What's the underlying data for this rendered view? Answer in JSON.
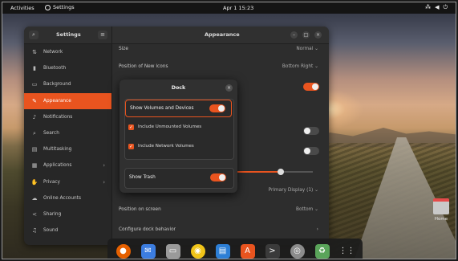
{
  "topbar": {
    "activities": "Activities",
    "app_name": "Settings",
    "clock": "Apr 1  15:23",
    "tray_icons": [
      "network-icon",
      "volume-icon",
      "power-icon"
    ]
  },
  "sidebar": {
    "title": "Settings",
    "items": [
      {
        "label": "Network",
        "icon": "network-icon"
      },
      {
        "label": "Bluetooth",
        "icon": "bluetooth-icon"
      },
      {
        "label": "Background",
        "icon": "background-icon"
      },
      {
        "label": "Appearance",
        "icon": "appearance-icon",
        "active": true
      },
      {
        "label": "Notifications",
        "icon": "bell-icon"
      },
      {
        "label": "Search",
        "icon": "search-icon"
      },
      {
        "label": "Multitasking",
        "icon": "multitasking-icon"
      },
      {
        "label": "Applications",
        "icon": "apps-icon",
        "chevron": true
      },
      {
        "label": "Privacy",
        "icon": "privacy-icon",
        "chevron": true
      },
      {
        "label": "Online Accounts",
        "icon": "cloud-icon"
      },
      {
        "label": "Sharing",
        "icon": "share-icon"
      },
      {
        "label": "Sound",
        "icon": "sound-icon"
      }
    ]
  },
  "main": {
    "title": "Appearance",
    "icon_size_label": "Size",
    "icon_size_value": "Normal",
    "new_icons_label": "Position of New Icons",
    "new_icons_value": "Bottom Right",
    "display_value": "Primary Display (1)",
    "position_label": "Position on screen",
    "position_value": "Bottom",
    "configure_label": "Configure dock behavior",
    "icon_size_slider_level": 0.6
  },
  "dock_dialog": {
    "title": "Dock",
    "show_volumes": {
      "label": "Show Volumes and Devices",
      "on": true
    },
    "unmounted": {
      "label": "Include Unmounted Volumes",
      "checked": true
    },
    "network": {
      "label": "Include Network Volumes",
      "checked": true
    },
    "show_trash": {
      "label": "Show Trash",
      "on": true
    }
  },
  "dock": {
    "apps": [
      {
        "name": "firefox-icon",
        "color": "#e66000"
      },
      {
        "name": "thunderbird-icon",
        "color": "#3c7de0"
      },
      {
        "name": "files-icon",
        "color": "#9a9a9a"
      },
      {
        "name": "rhythmbox-icon",
        "color": "#f0c419"
      },
      {
        "name": "writer-icon",
        "color": "#2d7fd6"
      },
      {
        "name": "software-icon",
        "color": "#e9541f"
      },
      {
        "name": "terminal-icon",
        "color": "#3a3a3a"
      },
      {
        "name": "settings-icon",
        "color": "#8c8c8c"
      },
      {
        "name": "trash-icon",
        "color": "#5aa45a"
      },
      {
        "name": "show-apps-icon",
        "color": "#ffffff"
      }
    ]
  },
  "desktop": {
    "home_label": "Home"
  },
  "colors": {
    "accent": "#e9541f",
    "window_bg": "#2d2d2d"
  }
}
